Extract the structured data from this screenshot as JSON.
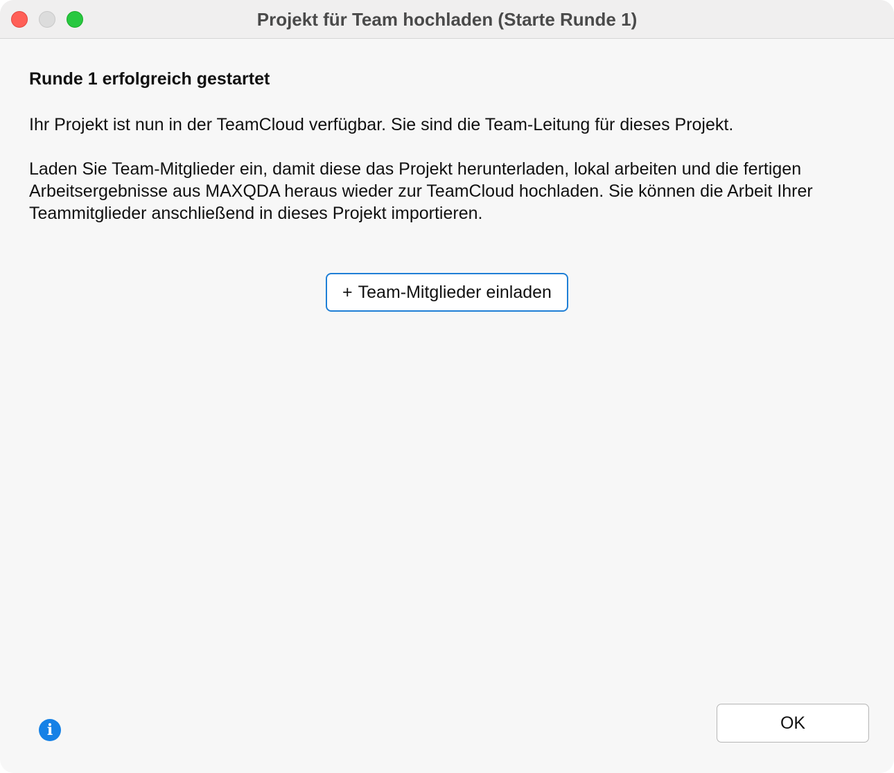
{
  "window": {
    "title": "Projekt für Team hochladen (Starte Runde 1)"
  },
  "content": {
    "heading": "Runde 1 erfolgreich gestartet",
    "paragraph1": "Ihr Projekt ist nun in der TeamCloud verfügbar. Sie sind die Team-Leitung für dieses Projekt.",
    "paragraph2_line1": "Laden Sie Team-Mitglieder ein, damit diese das Projekt herunterladen, lokal arbeiten und die fertigen",
    "paragraph2_line2": "Arbeitsergebnisse aus MAXQDA heraus wieder zur TeamCloud hochladen. Sie können die Arbeit Ihrer",
    "paragraph2_line3": "Teammitglieder anschließend in dieses Projekt importieren."
  },
  "buttons": {
    "invite_plus": "+",
    "invite_label": "Team-Mitglieder einladen",
    "ok_label": "OK"
  },
  "icons": {
    "info_glyph": "i",
    "info_color": "#1581e6",
    "accent_color": "#1f7fd6"
  }
}
